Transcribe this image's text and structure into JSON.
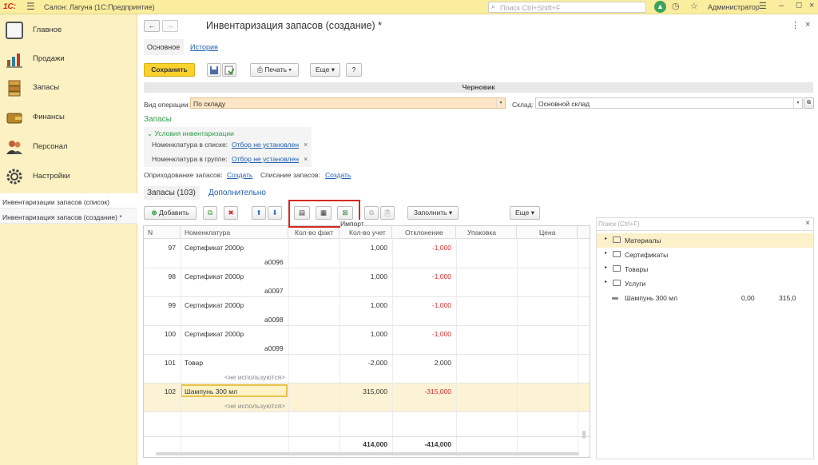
{
  "titlebar": {
    "logo": "1С:",
    "app_title": "Салон: Лагуна  (1С:Предприятие)",
    "search_placeholder": "Поиск Ctrl+Shift+F",
    "user": "Администратор"
  },
  "sidebar": {
    "items": [
      {
        "label": "Главное",
        "icon": "list-icon",
        "color": "#6a6a6a"
      },
      {
        "label": "Продажи",
        "icon": "chart-icon",
        "color": "#8a5a2a"
      },
      {
        "label": "Запасы",
        "icon": "boxes-icon",
        "color": "#c08030"
      },
      {
        "label": "Финансы",
        "icon": "wallet-icon",
        "color": "#a07020"
      },
      {
        "label": "Персонал",
        "icon": "people-icon",
        "color": "#b05030"
      },
      {
        "label": "Настройки",
        "icon": "gear-icon",
        "color": "#505050"
      }
    ],
    "open_windows": [
      "Инвентаризации запасов (список)",
      "Инвентаризация запасов (создание) *"
    ]
  },
  "form": {
    "title": "Инвентаризация запасов (создание) *",
    "tab_main": "Основное",
    "tab_history": "История",
    "save_label": "Сохранить",
    "print_label": "Печать",
    "more_label": "Еще",
    "help_label": "?",
    "status": "Черновик",
    "op_type_label": "Вид операции:",
    "op_type_value": "По складу",
    "warehouse_label": "Склад:",
    "warehouse_value": "Основной склад",
    "section_title": "Запасы",
    "conditions_title": "Условия инвентаризации",
    "nomenclature_list_label": "Номенклатура в списке:",
    "nomenclature_group_label": "Номенклатура в группе:",
    "filter_not_set": "Отбор не установлен",
    "receipt_label": "Оприходование запасов:",
    "writeoff_label": "Списание запасов:",
    "create_link": "Создать",
    "tab_inventory": "Запасы (103)",
    "tab_additional": "Дополнительно"
  },
  "grid_toolbar": {
    "add_label": "Добавить",
    "fill_label": "Заполнить",
    "more_label": "Еще",
    "import_tooltip": "Импорт"
  },
  "grid": {
    "headers": [
      "N",
      "Номенклатура",
      "Кол-во факт",
      "Кол-во учет",
      "Отклонение",
      "Упаковка",
      "Цена"
    ],
    "rows": [
      {
        "n": "97",
        "name": "Сертификат 2000р",
        "sub": "а0096",
        "fact": "",
        "acc": "1,000",
        "dev": "-1,000"
      },
      {
        "n": "98",
        "name": "Сертификат 2000р",
        "sub": "а0097",
        "fact": "",
        "acc": "1,000",
        "dev": "-1,000"
      },
      {
        "n": "99",
        "name": "Сертификат 2000р",
        "sub": "а0098",
        "fact": "",
        "acc": "1,000",
        "dev": "-1,000"
      },
      {
        "n": "100",
        "name": "Сертификат 2000р",
        "sub": "а0099",
        "fact": "",
        "acc": "1,000",
        "dev": "-1,000"
      },
      {
        "n": "101",
        "name": "Товар",
        "sub": "<не используются>",
        "fact": "",
        "acc": "-2,000",
        "dev": "2,000"
      },
      {
        "n": "102",
        "name": "Шампунь 300 мл",
        "sub": "<не используются>",
        "fact": "",
        "acc": "315,000",
        "dev": "-315,000"
      }
    ],
    "total_acc": "414,000",
    "total_dev": "-414,000"
  },
  "tree": {
    "search_placeholder": "Поиск (Ctrl+F)",
    "folders": [
      "Материалы",
      "Сертификаты",
      "Товары",
      "Услуги"
    ],
    "item": {
      "name": "Шампунь 300 мл",
      "qty": "0,00",
      "price": "315,0"
    }
  }
}
